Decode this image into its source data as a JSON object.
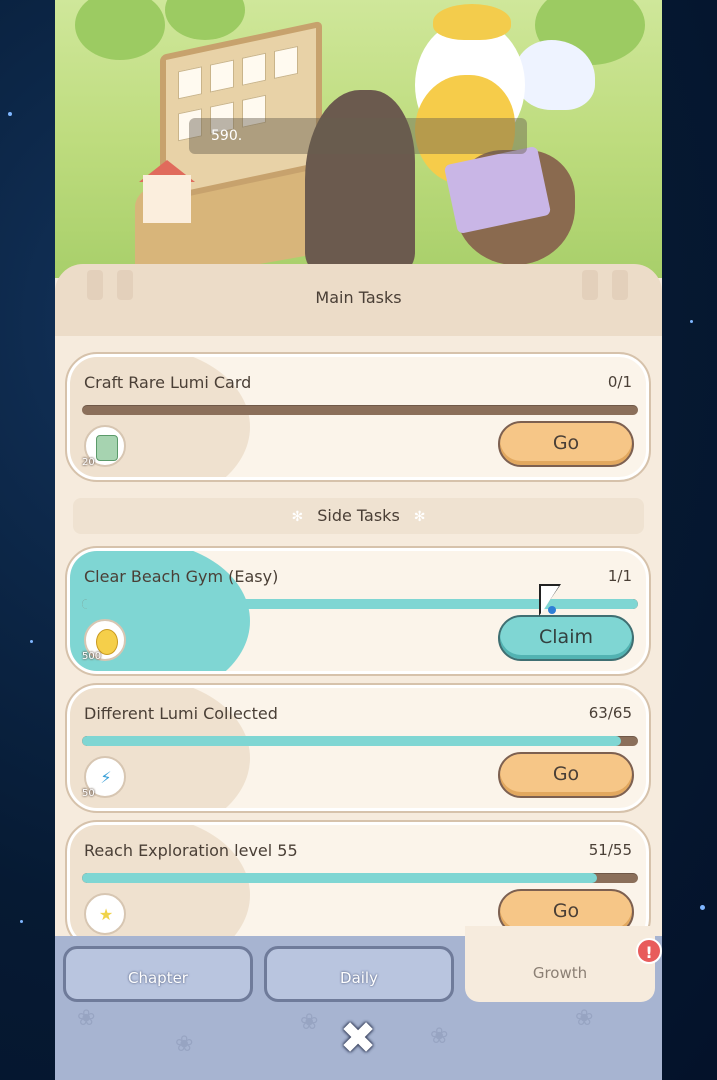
{
  "banner": {
    "counter_text": "590."
  },
  "main_tasks": {
    "title": "Main Tasks",
    "items": [
      {
        "title": "Craft Rare Lumi Card",
        "progress": "0/1",
        "progress_fraction": 0.0,
        "reward_icon": "card-icon",
        "reward_amount": "20",
        "button": "Go"
      }
    ]
  },
  "side_tasks": {
    "title": "Side Tasks",
    "items": [
      {
        "title": "Clear Beach Gym (Easy)",
        "progress": "1/1",
        "progress_fraction": 1.0,
        "reward_icon": "coin-icon",
        "reward_amount": "500",
        "button": "Claim"
      },
      {
        "title": "Different Lumi Collected",
        "progress": "63/65",
        "progress_fraction": 0.969,
        "reward_icon": "lightning-icon",
        "reward_amount": "50",
        "button": "Go"
      },
      {
        "title": "Reach Exploration level 55",
        "progress": "51/55",
        "progress_fraction": 0.927,
        "reward_icon": "star-icon",
        "reward_amount": "",
        "button": "Go"
      }
    ]
  },
  "tabs": [
    {
      "label": "Chapter",
      "active": false
    },
    {
      "label": "Daily",
      "active": false
    },
    {
      "label": "Growth",
      "active": true
    }
  ],
  "alert_badge": "!",
  "close_glyph": "✖",
  "colors": {
    "teal": "#7fd6d3",
    "go_button": "#f6c687",
    "panel": "#f6ebdd",
    "nav": "#a7b4d1",
    "alert": "#e85c5c"
  }
}
